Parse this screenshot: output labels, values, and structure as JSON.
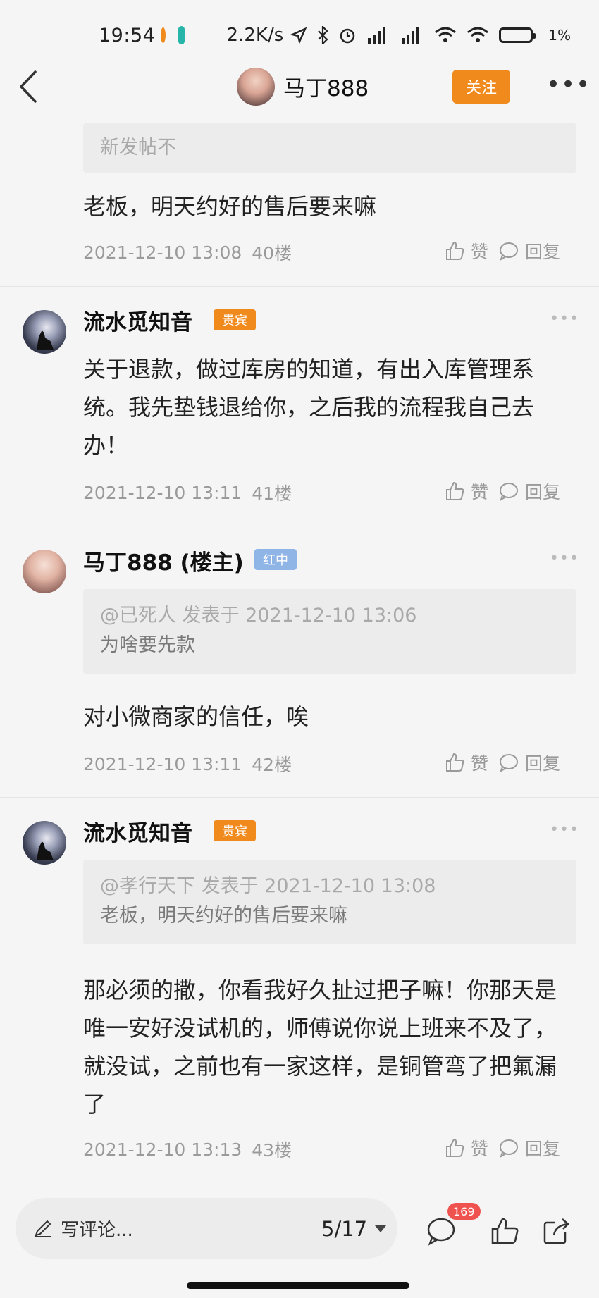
{
  "status_bar": {
    "time": "19:54",
    "net_speed": "2.2K/s",
    "battery": "1%"
  },
  "header": {
    "title": "马丁888",
    "follow_label": "关注"
  },
  "top_partial": {
    "quote_text": "新发帖不",
    "content": "老板，明天约好的售后要来嘛",
    "timestamp": "2021-12-10 13:08",
    "floor": "40楼"
  },
  "actions": {
    "like": "赞",
    "reply": "回复"
  },
  "posts": [
    {
      "username": "流水觅知音",
      "badge": "贵宾",
      "content": "关于退款，做过库房的知道，有出入库管理系统。我先垫钱退给你，之后我的流程我自己去办！",
      "timestamp": "2021-12-10 13:11",
      "floor": "41楼"
    },
    {
      "username": "马丁888 (楼主)",
      "badge": "红中",
      "quote_meta": "@已死人 发表于 2021-12-10 13:06",
      "quote_text": "为啥要先款",
      "content": "对小微商家的信任，唉",
      "timestamp": "2021-12-10 13:11",
      "floor": "42楼"
    },
    {
      "username": "流水觅知音",
      "badge": "贵宾",
      "quote_meta": "@孝行天下 发表于 2021-12-10 13:08",
      "quote_text": "老板，明天约好的售后要来嘛",
      "content": "那必须的撒，你看我好久扯过把子嘛！你那天是唯一安好没试机的，师傅说你说上班来不及了，就没试，之前也有一家这样，是铜管弯了把氟漏了",
      "timestamp": "2021-12-10 13:13",
      "floor": "43楼"
    }
  ],
  "bottom_bar": {
    "comment_placeholder": "写评论...",
    "page_indicator": "5/17",
    "comment_count": "169"
  },
  "colors": {
    "accent": "#f08a1c",
    "vip_badge": "#f18a1c",
    "red_badge": "#8fb4e6",
    "notif": "#ef5350"
  }
}
